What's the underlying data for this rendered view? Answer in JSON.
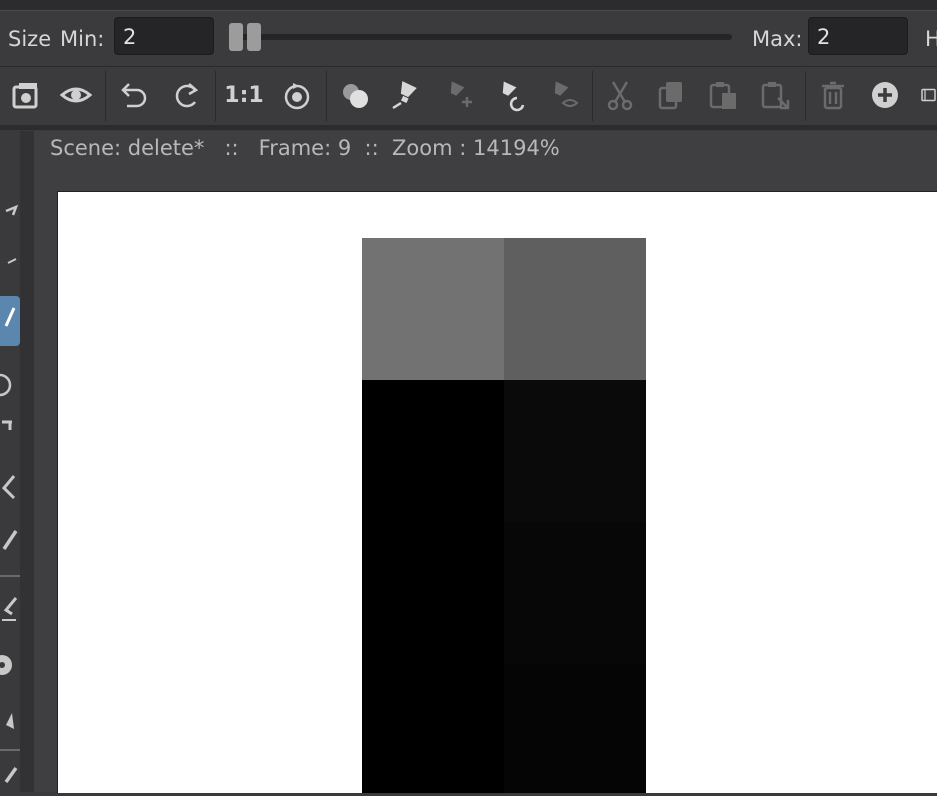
{
  "options_bar": {
    "size_label": "Size",
    "min_label": "Min:",
    "min_value": "2",
    "max_label": "Max:",
    "max_value": "2",
    "cut_label": "H"
  },
  "status": {
    "text": "Scene: delete*   ::   Frame: 9  ::  Zoom : 14194%"
  },
  "toolbar": {
    "actual_size_label": "1:1",
    "icons": [
      "save-icon",
      "eye-icon",
      "undo-icon",
      "redo-icon",
      "actual-size",
      "reset-rotation-icon",
      "fill-shapes-icon",
      "light-bulb-icon",
      "light-bulb-add-icon",
      "light-bulb-revert-icon",
      "light-bulb-visibility-icon",
      "cut-icon",
      "copy-icon",
      "paste-icon",
      "paste-into-icon",
      "delete-icon",
      "add-icon",
      "film-icon"
    ]
  },
  "colors": {
    "accent": "#5b86ad",
    "pixel_light_gray": "#727272",
    "pixel_mid_gray": "#5f5f5f",
    "pixel_black": "#000000",
    "pixel_near_black": "#0a0a0a",
    "pixel_near_black_2": "#070707",
    "pixel_near_black_3": "#050505"
  }
}
